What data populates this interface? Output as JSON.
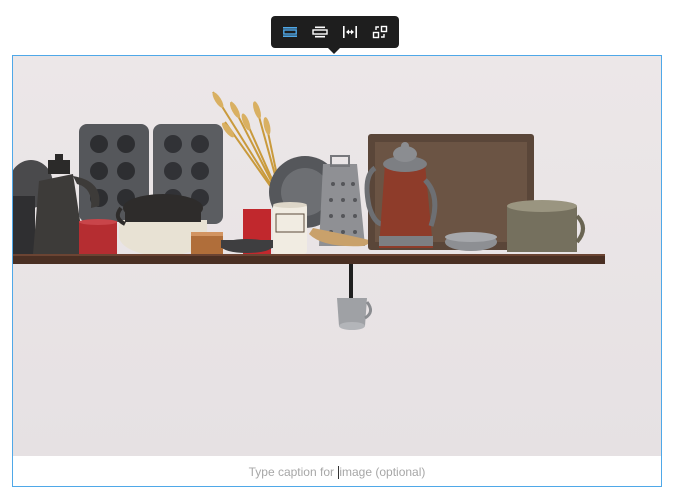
{
  "toolbar": {
    "buttons": [
      {
        "name": "align-wide-icon",
        "active": true
      },
      {
        "name": "align-center-icon",
        "active": false
      },
      {
        "name": "full-width-icon",
        "active": false
      },
      {
        "name": "replace-icon",
        "active": false
      }
    ]
  },
  "image": {
    "alt": "Kitchen shelf with vintage cookware"
  },
  "caption": {
    "placeholder_before": "Type caption for ",
    "placeholder_after": "image (optional)"
  },
  "colors": {
    "selection_border": "#4fa8e8",
    "toolbar_bg": "#1e1e1e",
    "active_icon": "#4fa8e8"
  }
}
